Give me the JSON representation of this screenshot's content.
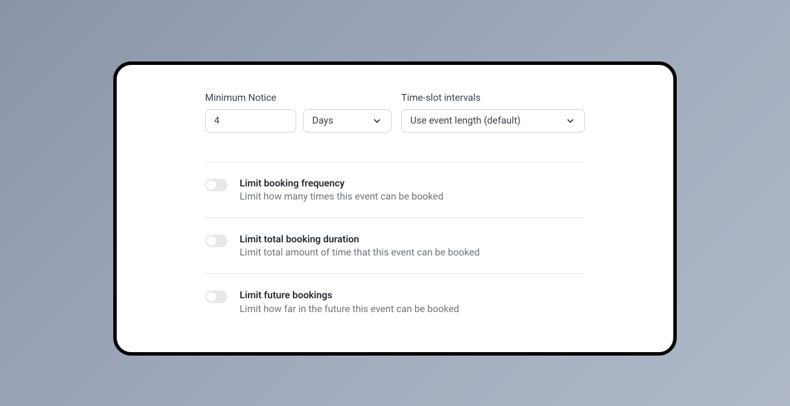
{
  "minimumNotice": {
    "label": "Minimum Notice",
    "value": "4",
    "unit": "Days"
  },
  "timeSlotIntervals": {
    "label": "Time-slot intervals",
    "value": "Use event length (default)"
  },
  "options": [
    {
      "title": "Limit booking frequency",
      "description": "Limit how many times this event can be booked",
      "enabled": false
    },
    {
      "title": "Limit total booking duration",
      "description": "Limit total amount of time that this event can be booked",
      "enabled": false
    },
    {
      "title": "Limit future bookings",
      "description": "Limit how far in the future this event can be booked",
      "enabled": false
    }
  ]
}
